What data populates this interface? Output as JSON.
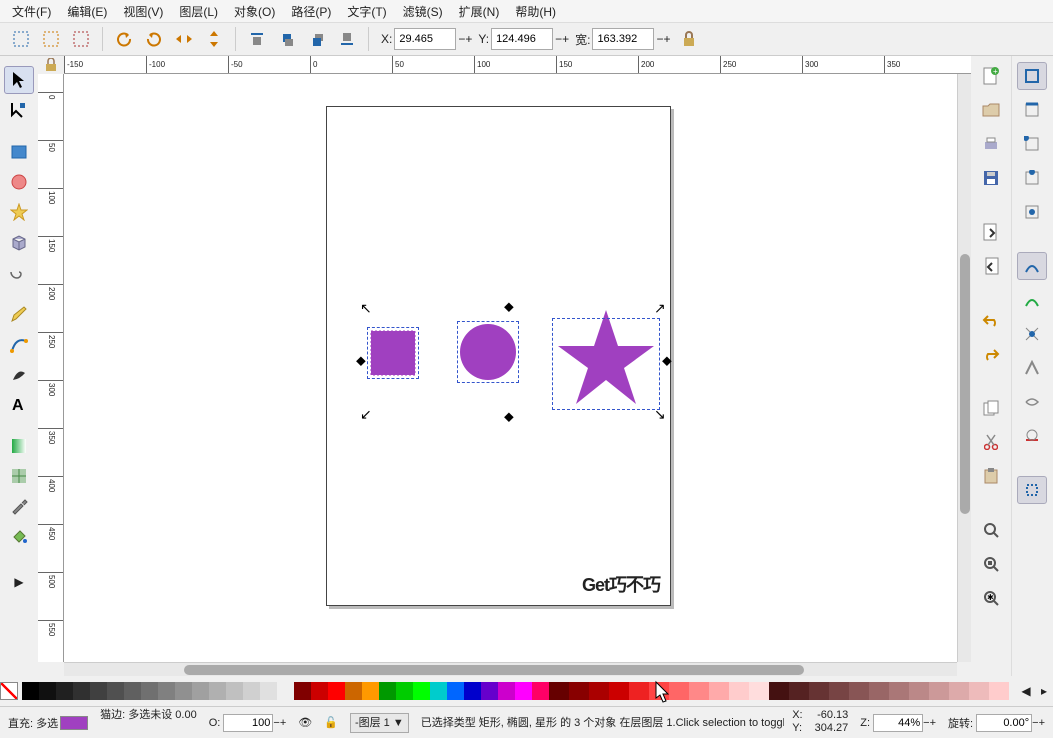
{
  "menus": [
    "文件(F)",
    "编辑(E)",
    "视图(V)",
    "图层(L)",
    "对象(O)",
    "路径(P)",
    "文字(T)",
    "滤镜(S)",
    "扩展(N)",
    "帮助(H)"
  ],
  "toolbar": {
    "x_label": "X:",
    "x_val": "29.465",
    "y_label": "Y:",
    "y_val": "124.496",
    "w_label": "宽:",
    "w_val": "163.392"
  },
  "ruler_h": [
    -150,
    -100,
    -50,
    0,
    50,
    100,
    150,
    200,
    250,
    300,
    350
  ],
  "ruler_v": [
    0,
    50,
    100,
    150,
    200,
    250,
    300,
    350,
    400,
    450,
    500,
    550
  ],
  "watermark": "Get巧不巧",
  "palette_grays": [
    "#000000",
    "#101010",
    "#202020",
    "#303030",
    "#404040",
    "#505050",
    "#606060",
    "#707070",
    "#808080",
    "#909090",
    "#a0a0a0",
    "#b0b0b0",
    "#c0c0c0",
    "#d0d0d0",
    "#e0e0e0",
    "#f0f0f0"
  ],
  "palette_hues": [
    "#800000",
    "#cc0000",
    "#ff0000",
    "#cc6600",
    "#ff9900",
    "#009900",
    "#00cc00",
    "#00ff00",
    "#00cccc",
    "#0066ff",
    "#0000cc",
    "#6600cc",
    "#cc00cc",
    "#ff00ff",
    "#ff0066"
  ],
  "palette_reds": [
    "#660000",
    "#880000",
    "#aa0000",
    "#cc0000",
    "#ee2222",
    "#ff4444",
    "#ff6666",
    "#ff8888",
    "#ffaaaa",
    "#ffcccc",
    "#ffdddd",
    "#441111",
    "#552222",
    "#663333",
    "#774444",
    "#885555",
    "#996666",
    "#aa7777",
    "#bb8888",
    "#cc9999",
    "#ddaaaa",
    "#eebbbb",
    "#ffcccc"
  ],
  "status": {
    "fill_label": "直充:",
    "fill_val": "多选",
    "stroke_label": "猫边:",
    "stroke_val": "多选未设 0.00",
    "o_label": "O:",
    "o_val": "100",
    "layer": "-图层 1 ▼",
    "msg1": "已选择类型 矩形, 椭圆, 星形 的 3 个对象 在层图层 1.",
    "msg2": "Click selection to toggle scale/rotation handles (or Shift...",
    "x_label": "X:",
    "x_val": "-60.13",
    "y_label": "Y:",
    "y_val": "304.27",
    "z_label": "Z:",
    "z_val": "44%",
    "rot_label": "旋转:",
    "rot_val": "0.00°"
  }
}
